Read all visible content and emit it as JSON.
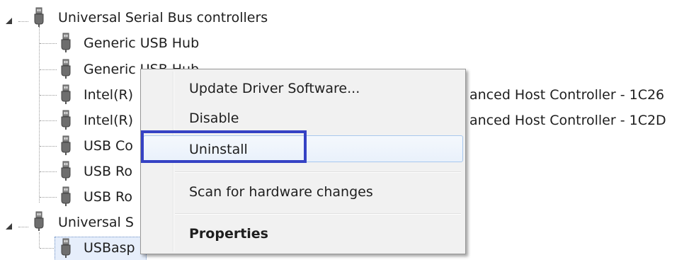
{
  "tree": {
    "categories": [
      {
        "label": "Universal Serial Bus controllers"
      },
      {
        "label": "Universal S"
      }
    ],
    "children": [
      {
        "label": "Generic USB Hub"
      },
      {
        "label": "Generic USB Hub"
      },
      {
        "label": "Intel(R)"
      },
      {
        "label": "Intel(R)"
      },
      {
        "label": "USB Co"
      },
      {
        "label": "USB Ro"
      },
      {
        "label": "USB Ro"
      },
      {
        "label": "USBasp"
      }
    ],
    "hidden_tails": [
      "anced Host Controller - 1C26",
      "anced Host Controller - 1C2D"
    ]
  },
  "context_menu": {
    "items": [
      {
        "label": "Update Driver Software..."
      },
      {
        "label": "Disable"
      },
      {
        "label": "Uninstall"
      },
      {
        "label": "Scan for hardware changes"
      },
      {
        "label": "Properties"
      }
    ]
  },
  "colors": {
    "highlight_border": "#3542c4",
    "menu_background": "#f1f1f1",
    "hover_border": "#a8c8ee"
  },
  "icons": {
    "usb_device": "usb-plug-icon",
    "expander": "expanded-triangle-icon"
  }
}
